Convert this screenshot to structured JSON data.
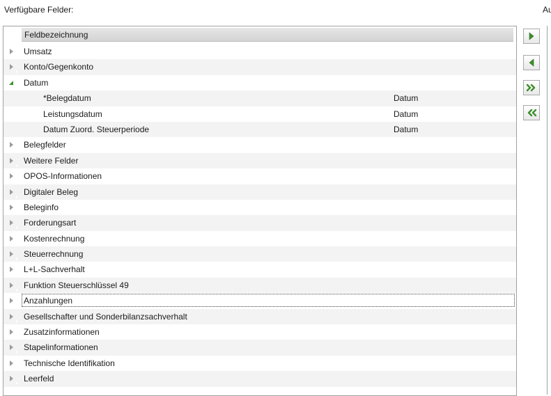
{
  "labels": {
    "available_fields": "Verfügbare Felder:",
    "right_cut": "Au"
  },
  "table": {
    "header": "Feldbezeichnung"
  },
  "tree": [
    {
      "label": "Umsatz",
      "level": 0,
      "expanded": false
    },
    {
      "label": "Konto/Gegenkonto",
      "level": 0,
      "expanded": false
    },
    {
      "label": "Datum",
      "level": 0,
      "expanded": true
    },
    {
      "label": "*Belegdatum",
      "level": 1,
      "type": "Datum"
    },
    {
      "label": "Leistungsdatum",
      "level": 1,
      "type": "Datum"
    },
    {
      "label": "Datum Zuord. Steuerperiode",
      "level": 1,
      "type": "Datum"
    },
    {
      "label": "Belegfelder",
      "level": 0,
      "expanded": false
    },
    {
      "label": "Weitere Felder",
      "level": 0,
      "expanded": false
    },
    {
      "label": "OPOS-Informationen",
      "level": 0,
      "expanded": false
    },
    {
      "label": "Digitaler Beleg",
      "level": 0,
      "expanded": false
    },
    {
      "label": "Beleginfo",
      "level": 0,
      "expanded": false
    },
    {
      "label": "Forderungsart",
      "level": 0,
      "expanded": false
    },
    {
      "label": "Kostenrechnung",
      "level": 0,
      "expanded": false
    },
    {
      "label": "Steuerrechnung",
      "level": 0,
      "expanded": false
    },
    {
      "label": "L+L-Sachverhalt",
      "level": 0,
      "expanded": false
    },
    {
      "label": "Funktion Steuerschlüssel 49",
      "level": 0,
      "expanded": false
    },
    {
      "label": "Anzahlungen",
      "level": 0,
      "expanded": false,
      "focused": true
    },
    {
      "label": "Gesellschafter und Sonderbilanzsachverhalt",
      "level": 0,
      "expanded": false
    },
    {
      "label": "Zusatzinformationen",
      "level": 0,
      "expanded": false
    },
    {
      "label": "Stapelinformationen",
      "level": 0,
      "expanded": false
    },
    {
      "label": "Technische Identifikation",
      "level": 0,
      "expanded": false
    },
    {
      "label": "Leerfeld",
      "level": 0,
      "expanded": false
    }
  ],
  "buttons": [
    {
      "id": "add",
      "icon": "chevron-right-icon"
    },
    {
      "id": "remove",
      "icon": "chevron-left-icon"
    },
    {
      "id": "add-all",
      "icon": "double-chevron-right-icon"
    },
    {
      "id": "remove-all",
      "icon": "double-chevron-left-icon"
    }
  ],
  "colors": {
    "accent_green": "#3e8f2c",
    "row_alt": "#f3f3f3"
  }
}
